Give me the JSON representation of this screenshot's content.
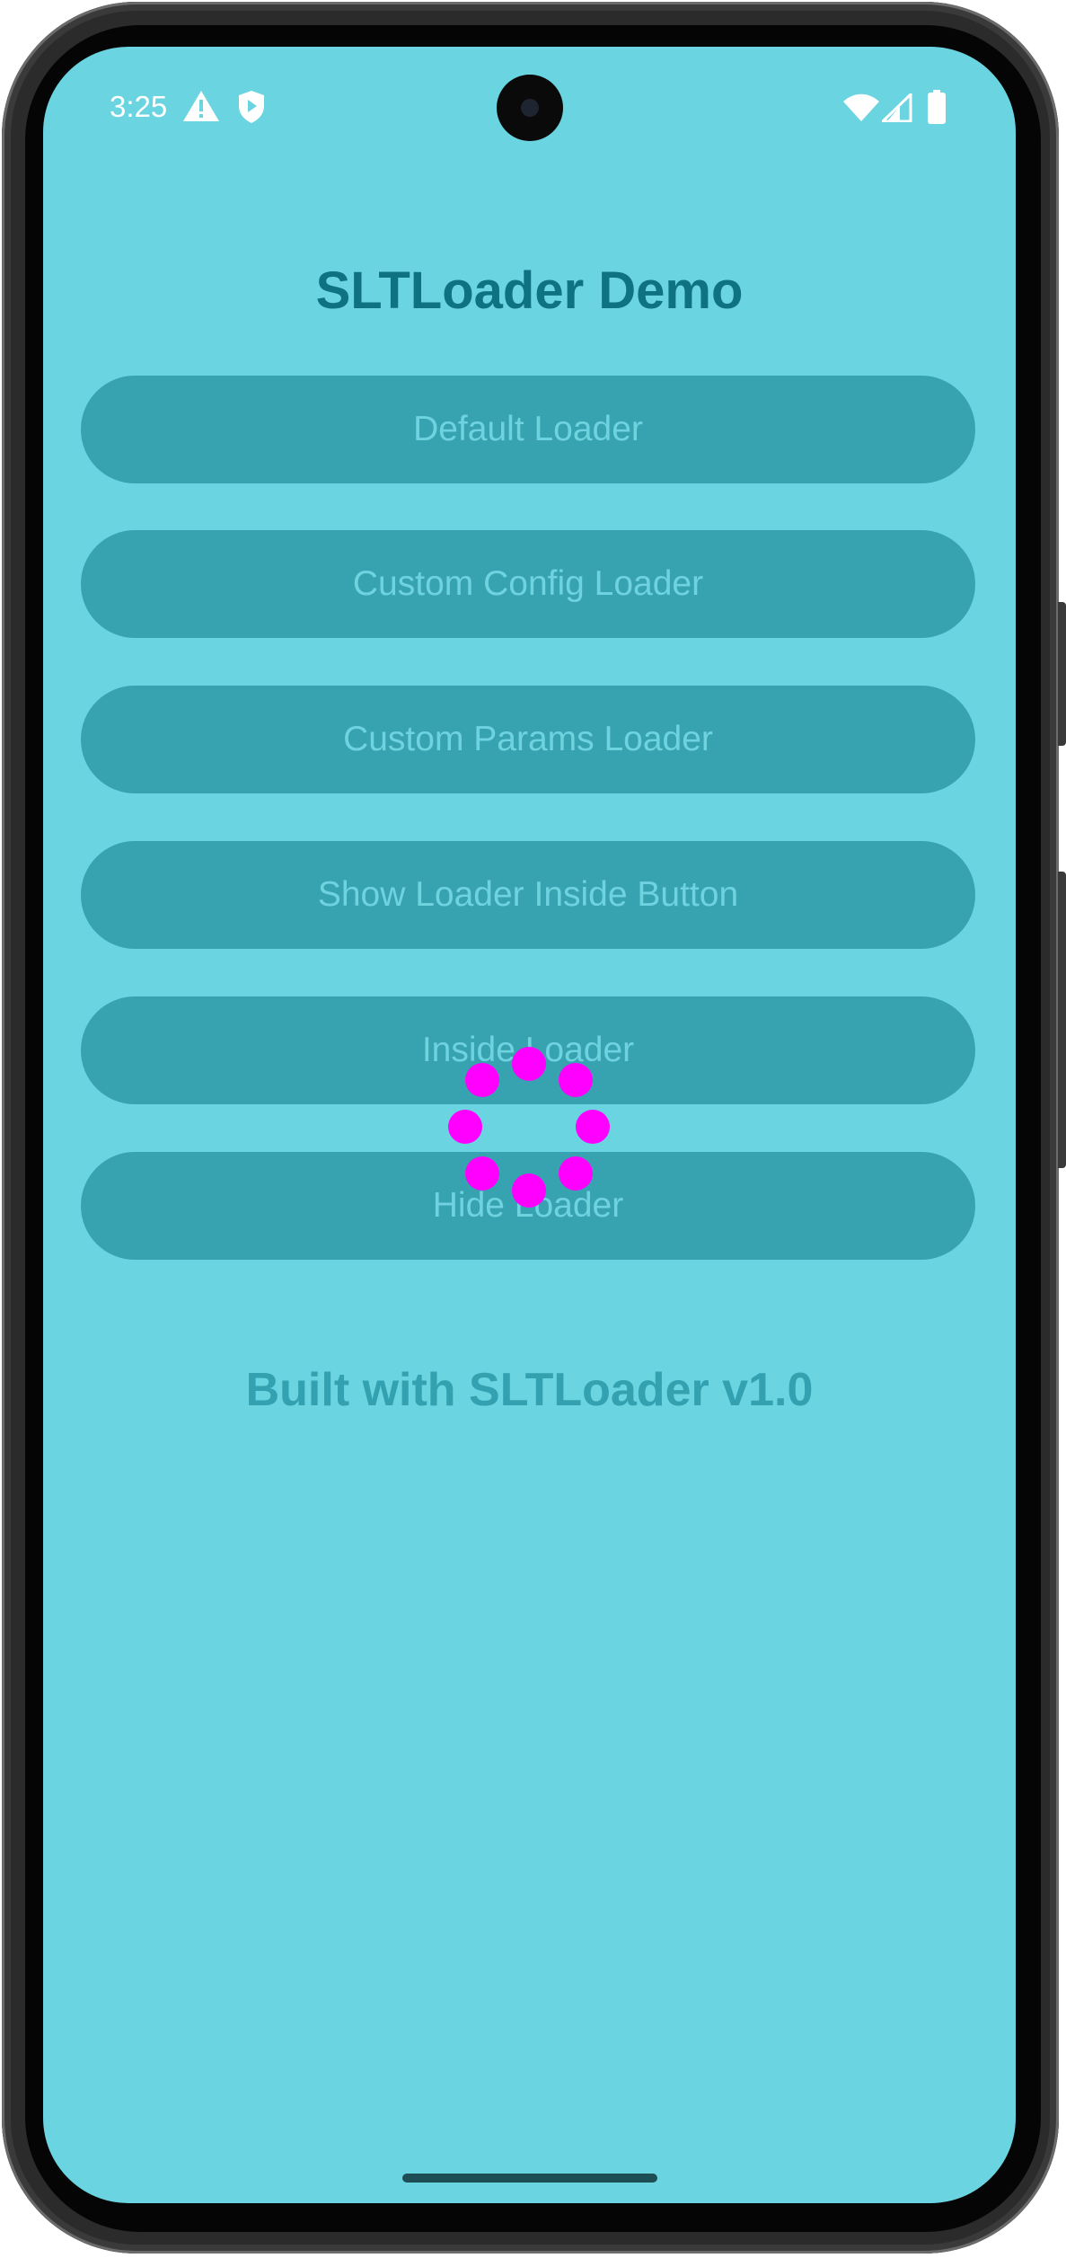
{
  "status_bar": {
    "time": "3:25",
    "left_icons": [
      "warning-icon",
      "shield-icon"
    ],
    "right_icons": [
      "wifi-icon",
      "cell-signal-icon",
      "battery-icon"
    ]
  },
  "app": {
    "title": "SLTLoader Demo",
    "buttons": [
      {
        "label": "Default Loader"
      },
      {
        "label": "Custom Config Loader"
      },
      {
        "label": "Custom Params Loader"
      },
      {
        "label": "Show Loader Inside Button"
      },
      {
        "label": "Inside Loader"
      },
      {
        "label": "Hide Loader"
      }
    ],
    "footer": "Built with SLTLoader v1.0"
  },
  "colors": {
    "background": "#6ad4e1",
    "title": "#0f7282",
    "button_bg": "#38a3b0",
    "button_text": "#6fd2df",
    "footer_text": "#33a1b0",
    "spinner_dots": "#ff00ff"
  }
}
